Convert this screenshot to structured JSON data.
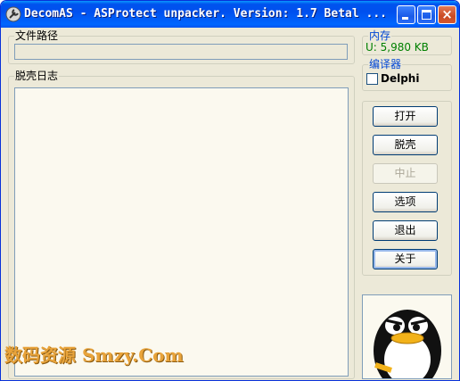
{
  "window": {
    "title": "DecomAS - ASProtect unpacker. Version: 1.7 Betal ...",
    "icon": "wrench-icon",
    "controls": {
      "minimize": "minimize-icon",
      "maximize": "maximize-icon",
      "close": "×"
    }
  },
  "file_path": {
    "label": "文件路径",
    "value": ""
  },
  "log": {
    "label": "脱壳日志",
    "content": ""
  },
  "memory": {
    "label": "内存",
    "value": "U: 5,980 KB",
    "value_color": "#008000"
  },
  "compiler": {
    "label": "编译器",
    "checkbox_label": "Delphi",
    "checked": false
  },
  "buttons": {
    "open": "打开",
    "unpack": "脱壳",
    "stop": "中止",
    "options": "选项",
    "exit": "退出",
    "about": "关于"
  },
  "logo": {
    "icon": "penguin-icon"
  },
  "watermark": {
    "text": "数码资源 Smzy.Com",
    "color": "#e8a33a"
  }
}
